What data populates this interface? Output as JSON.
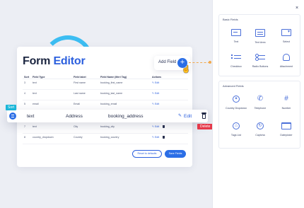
{
  "editor": {
    "title_part1": "Form",
    "title_part2": "Editor",
    "headers": [
      "Sort",
      "Field Type",
      "Field label",
      "Field Name (Meri Tag)",
      "Actions"
    ],
    "rows": [
      {
        "no": "3",
        "type": "text",
        "label": "First name",
        "name": "booking_first_name",
        "action": "Edit"
      },
      {
        "no": "4",
        "type": "text",
        "label": "Last name",
        "name": "booking_last_name",
        "action": "Edit"
      },
      {
        "no": "5",
        "type": "email",
        "label": "Email",
        "name": "booking_email",
        "action": "Edit"
      },
      {
        "no": "7",
        "type": "text",
        "label": "City",
        "name": "booking_city",
        "action": "Edit"
      },
      {
        "no": "8",
        "type": "country_dropdown",
        "label": "Country",
        "name": "booking_country",
        "action": "Edit"
      }
    ],
    "reset_label": "Reset to defaults",
    "save_label": "Save Fields"
  },
  "add_field": {
    "label": "Add Field",
    "plus": "+"
  },
  "drag_row": {
    "sort_badge": "Sort",
    "type": "text",
    "label": "Address",
    "name": "booking_address",
    "edit": "Edit",
    "delete_badge": "Delete"
  },
  "panel": {
    "close": "×",
    "basic_title": "Basic Fields",
    "basic_fields": [
      {
        "label": "Text",
        "icon": "text-field-icon"
      },
      {
        "label": "Text Area",
        "icon": "textarea-icon"
      },
      {
        "label": "Select",
        "icon": "select-icon"
      },
      {
        "label": "Checkbox",
        "icon": "checkbox-list-icon"
      },
      {
        "label": "Radio Buttons",
        "icon": "radio-buttons-icon"
      },
      {
        "label": "Attachment",
        "icon": "attachment-icon"
      }
    ],
    "advanced_title": "Advanced Fields",
    "advanced_fields": [
      {
        "label": "Country Dropdown",
        "icon": "globe-icon"
      },
      {
        "label": "Telephone",
        "icon": "phone-icon"
      },
      {
        "label": "Number",
        "icon": "number-icon"
      },
      {
        "label": "Tags List",
        "icon": "tags-icon"
      },
      {
        "label": "Captcha",
        "icon": "captcha-icon"
      },
      {
        "label": "Datepicker",
        "icon": "calendar-icon"
      }
    ]
  },
  "colors": {
    "primary": "#2b6ee6",
    "sort_badge": "#19b6d8",
    "delete_badge": "#e5394a",
    "connector": "#f2a84a"
  }
}
